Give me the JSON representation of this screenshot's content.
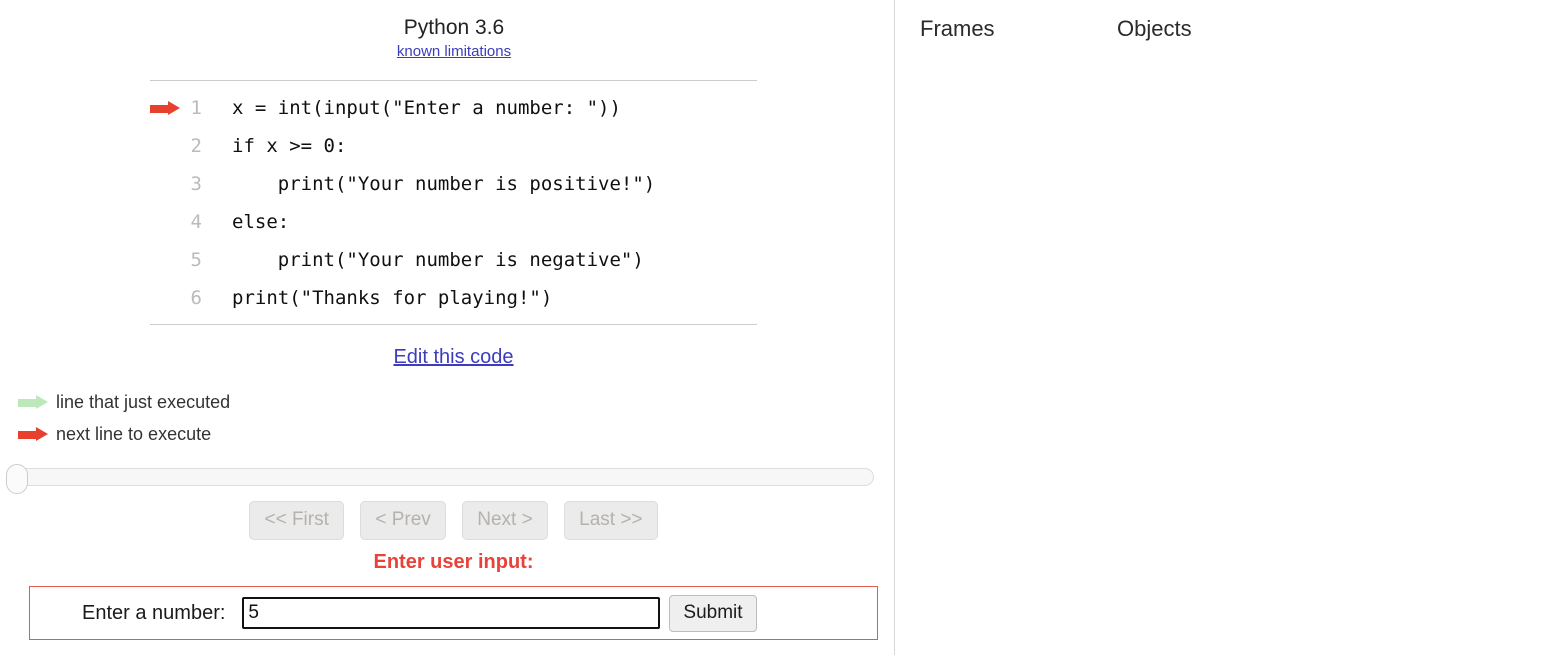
{
  "header": {
    "version_label": "Python 3.6",
    "limitations_link": "known limitations"
  },
  "code": {
    "lines": [
      {
        "number": "1",
        "text": "x = int(input(\"Enter a number: \"))",
        "arrow": "red"
      },
      {
        "number": "2",
        "text": "if x >= 0:",
        "arrow": "none"
      },
      {
        "number": "3",
        "text": "    print(\"Your number is positive!\")",
        "arrow": "none"
      },
      {
        "number": "4",
        "text": "else:",
        "arrow": "none"
      },
      {
        "number": "5",
        "text": "    print(\"Your number is negative\")",
        "arrow": "none"
      },
      {
        "number": "6",
        "text": "print(\"Thanks for playing!\")",
        "arrow": "none"
      }
    ],
    "edit_link": "Edit this code"
  },
  "legend": {
    "executed_label": "line that just executed",
    "next_label": "next line to execute"
  },
  "controls": {
    "first_label": "<< First",
    "prev_label": "< Prev",
    "next_label": "Next >",
    "last_label": "Last >>",
    "slider_position_percent": "0"
  },
  "user_input": {
    "prompt": "Enter user input:",
    "field_label": "Enter a number:",
    "field_value": "5",
    "field_placeholder": "",
    "submit_label": "Submit"
  },
  "right_panel": {
    "frames_heading": "Frames",
    "objects_heading": "Objects"
  },
  "colors": {
    "next_line_arrow": "#e8402f",
    "executed_line_arrow": "#bce8bc",
    "link": "#3c3cbd",
    "prompt_red": "#e8433a",
    "input_border_red": "#e05b50"
  }
}
